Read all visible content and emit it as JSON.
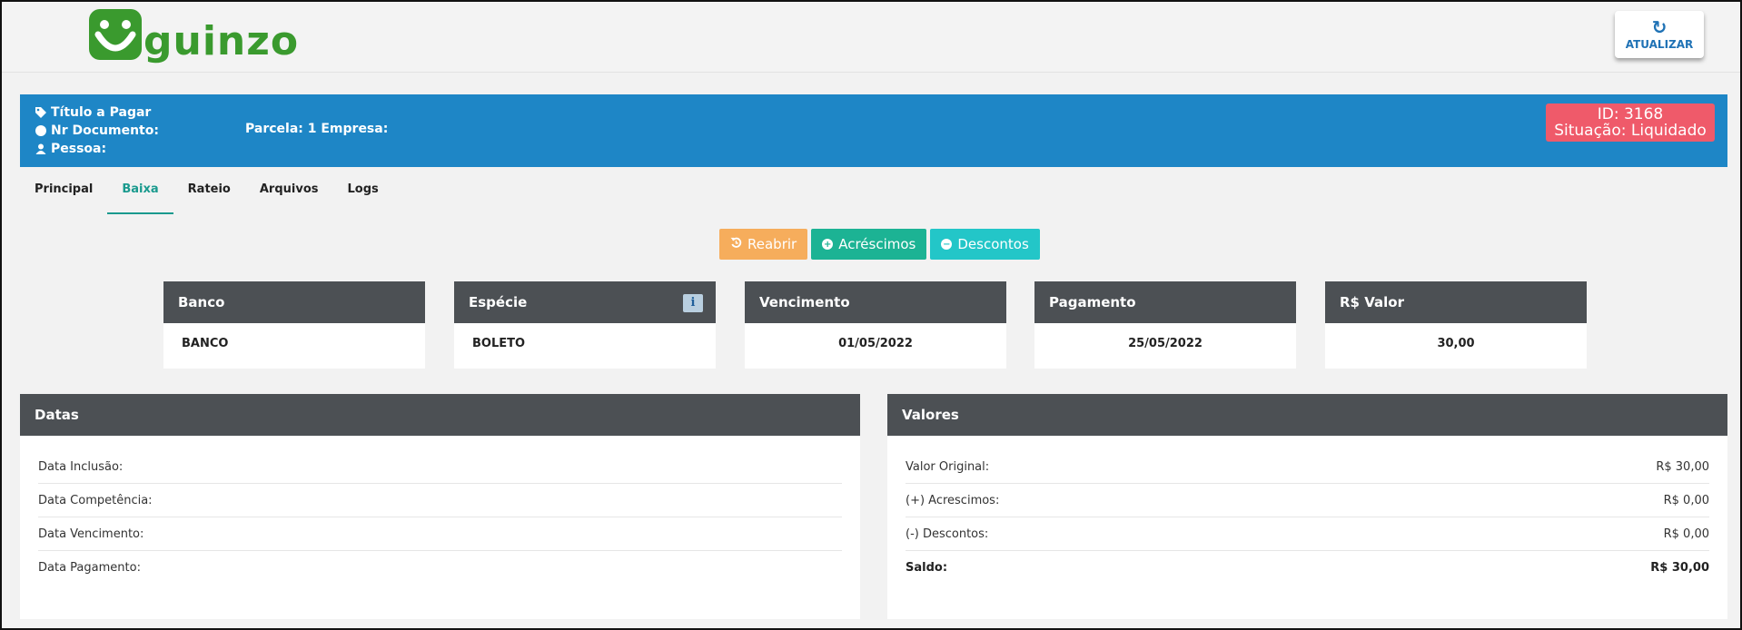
{
  "header": {
    "logo_text": "guinzo",
    "refresh_label": "ATUALIZAR",
    "refresh_icon": "↻"
  },
  "banner": {
    "title": "Título a Pagar",
    "nr_documento": "Nr Documento:",
    "pessoa": "Pessoa:",
    "parcela": "Parcela: 1 Empresa:",
    "id_label": "ID: 3168",
    "situacao_label": "Situação: Liquidado",
    "badge_color": "#ef5a6a",
    "bg_color": "#1e86c6"
  },
  "tabs": [
    {
      "label": "Principal",
      "active": false
    },
    {
      "label": "Baixa",
      "active": true
    },
    {
      "label": "Rateio",
      "active": false
    },
    {
      "label": "Arquivos",
      "active": false
    },
    {
      "label": "Logs",
      "active": false
    }
  ],
  "actions": {
    "reabrir": "Reabrir",
    "acrescimos": "Acréscimos",
    "descontos": "Descontos"
  },
  "cards": [
    {
      "title": "Banco",
      "value": "BANCO"
    },
    {
      "title": "Espécie",
      "value": "BOLETO"
    },
    {
      "title": "Vencimento",
      "value": "01/05/2022"
    },
    {
      "title": "Pagamento",
      "value": "25/05/2022"
    },
    {
      "title": "R$ Valor",
      "value": "30,00"
    }
  ],
  "datas": {
    "title": "Datas",
    "rows": [
      {
        "label": "Data Inclusão:",
        "value": ""
      },
      {
        "label": "Data Competência:",
        "value": ""
      },
      {
        "label": "Data Vencimento:",
        "value": ""
      },
      {
        "label": "Data Pagamento:",
        "value": ""
      }
    ]
  },
  "valores": {
    "title": "Valores",
    "rows": [
      {
        "label": "Valor Original:",
        "value": "R$ 30,00"
      },
      {
        "label": "(+) Acrescimos:",
        "value": "R$ 0,00"
      },
      {
        "label": "(-) Descontos:",
        "value": "R$ 0,00"
      },
      {
        "label": "Saldo:",
        "value": "R$ 30,00"
      }
    ]
  }
}
